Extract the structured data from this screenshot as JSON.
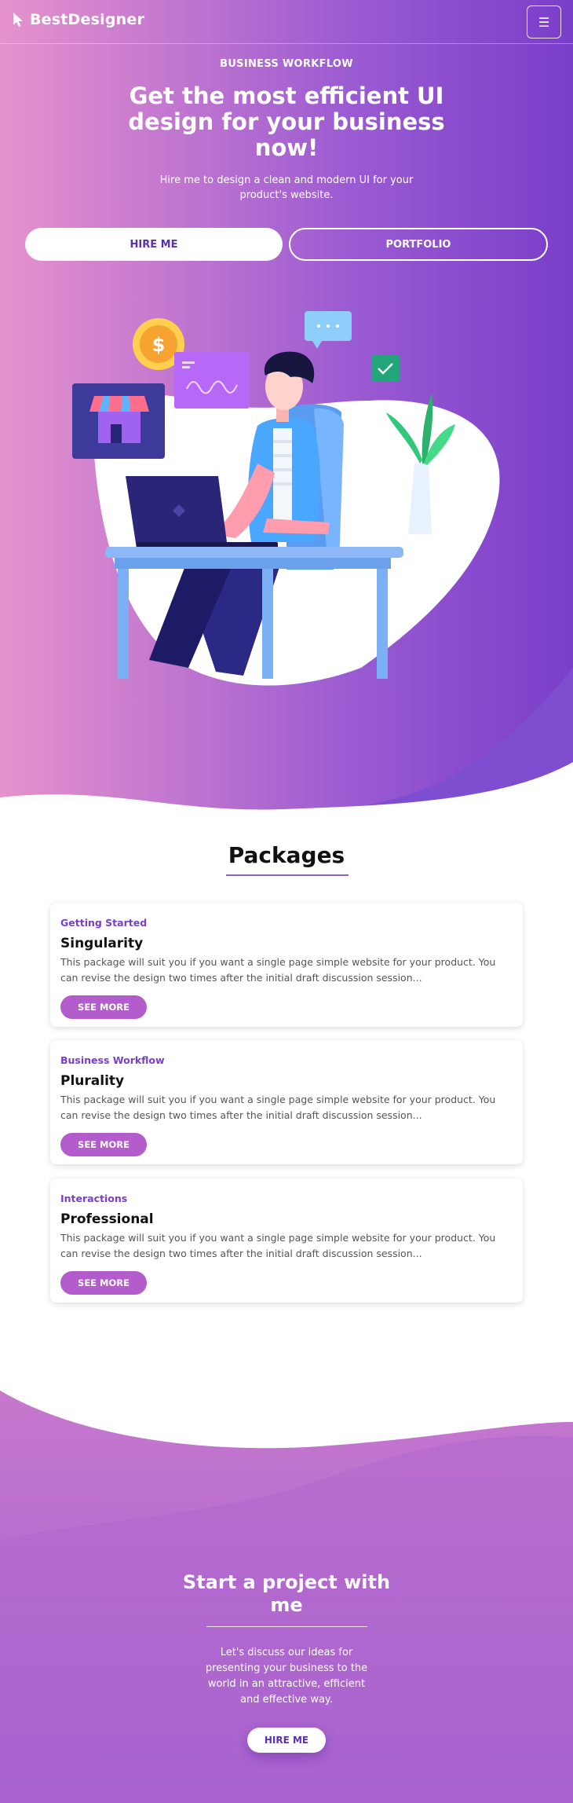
{
  "nav": {
    "brand": "BestDesigner",
    "menu_icon": "☰"
  },
  "hero": {
    "eyebrow": "BUSINESS WORKFLOW",
    "title": "Get the most efficient UI design for your business now!",
    "subtitle": "Hire me to design a clean and modern UI for your product's website.",
    "primary_button": "HIRE ME",
    "secondary_button": "PORTFOLIO",
    "coin_symbol": "$"
  },
  "packages": {
    "title": "Packages",
    "items": [
      {
        "category": "Getting Started",
        "title": "Singularity",
        "description": "This package will suit you if you want a single page simple website for your product. You can revise the design two times after the initial draft discussion session...",
        "button": "SEE MORE"
      },
      {
        "category": "Business Workflow",
        "title": "Plurality",
        "description": "This package will suit you if you want a single page simple website for your product. You can revise the design two times after the initial draft discussion session...",
        "button": "SEE MORE"
      },
      {
        "category": "Interactions",
        "title": "Professional",
        "description": "This package will suit you if you want a single page simple website for your product. You can revise the design two times after the initial draft discussion session...",
        "button": "SEE MORE"
      }
    ]
  },
  "cta": {
    "title": "Start a project with me",
    "subtitle": "Let's discuss our ideas for presenting your business to the world in an attractive, efficient and effective way.",
    "button": "HIRE ME"
  },
  "colors": {
    "primary": "#7a3ec9",
    "accent": "#b35ccc",
    "pink": "#e692cd"
  },
  "icons": [
    "cursor-logo-icon",
    "hamburger-menu-icon",
    "dollar-coin-icon",
    "chat-bubble-icon",
    "checkbox-icon",
    "storefront-icon",
    "waveform-card-icon"
  ]
}
